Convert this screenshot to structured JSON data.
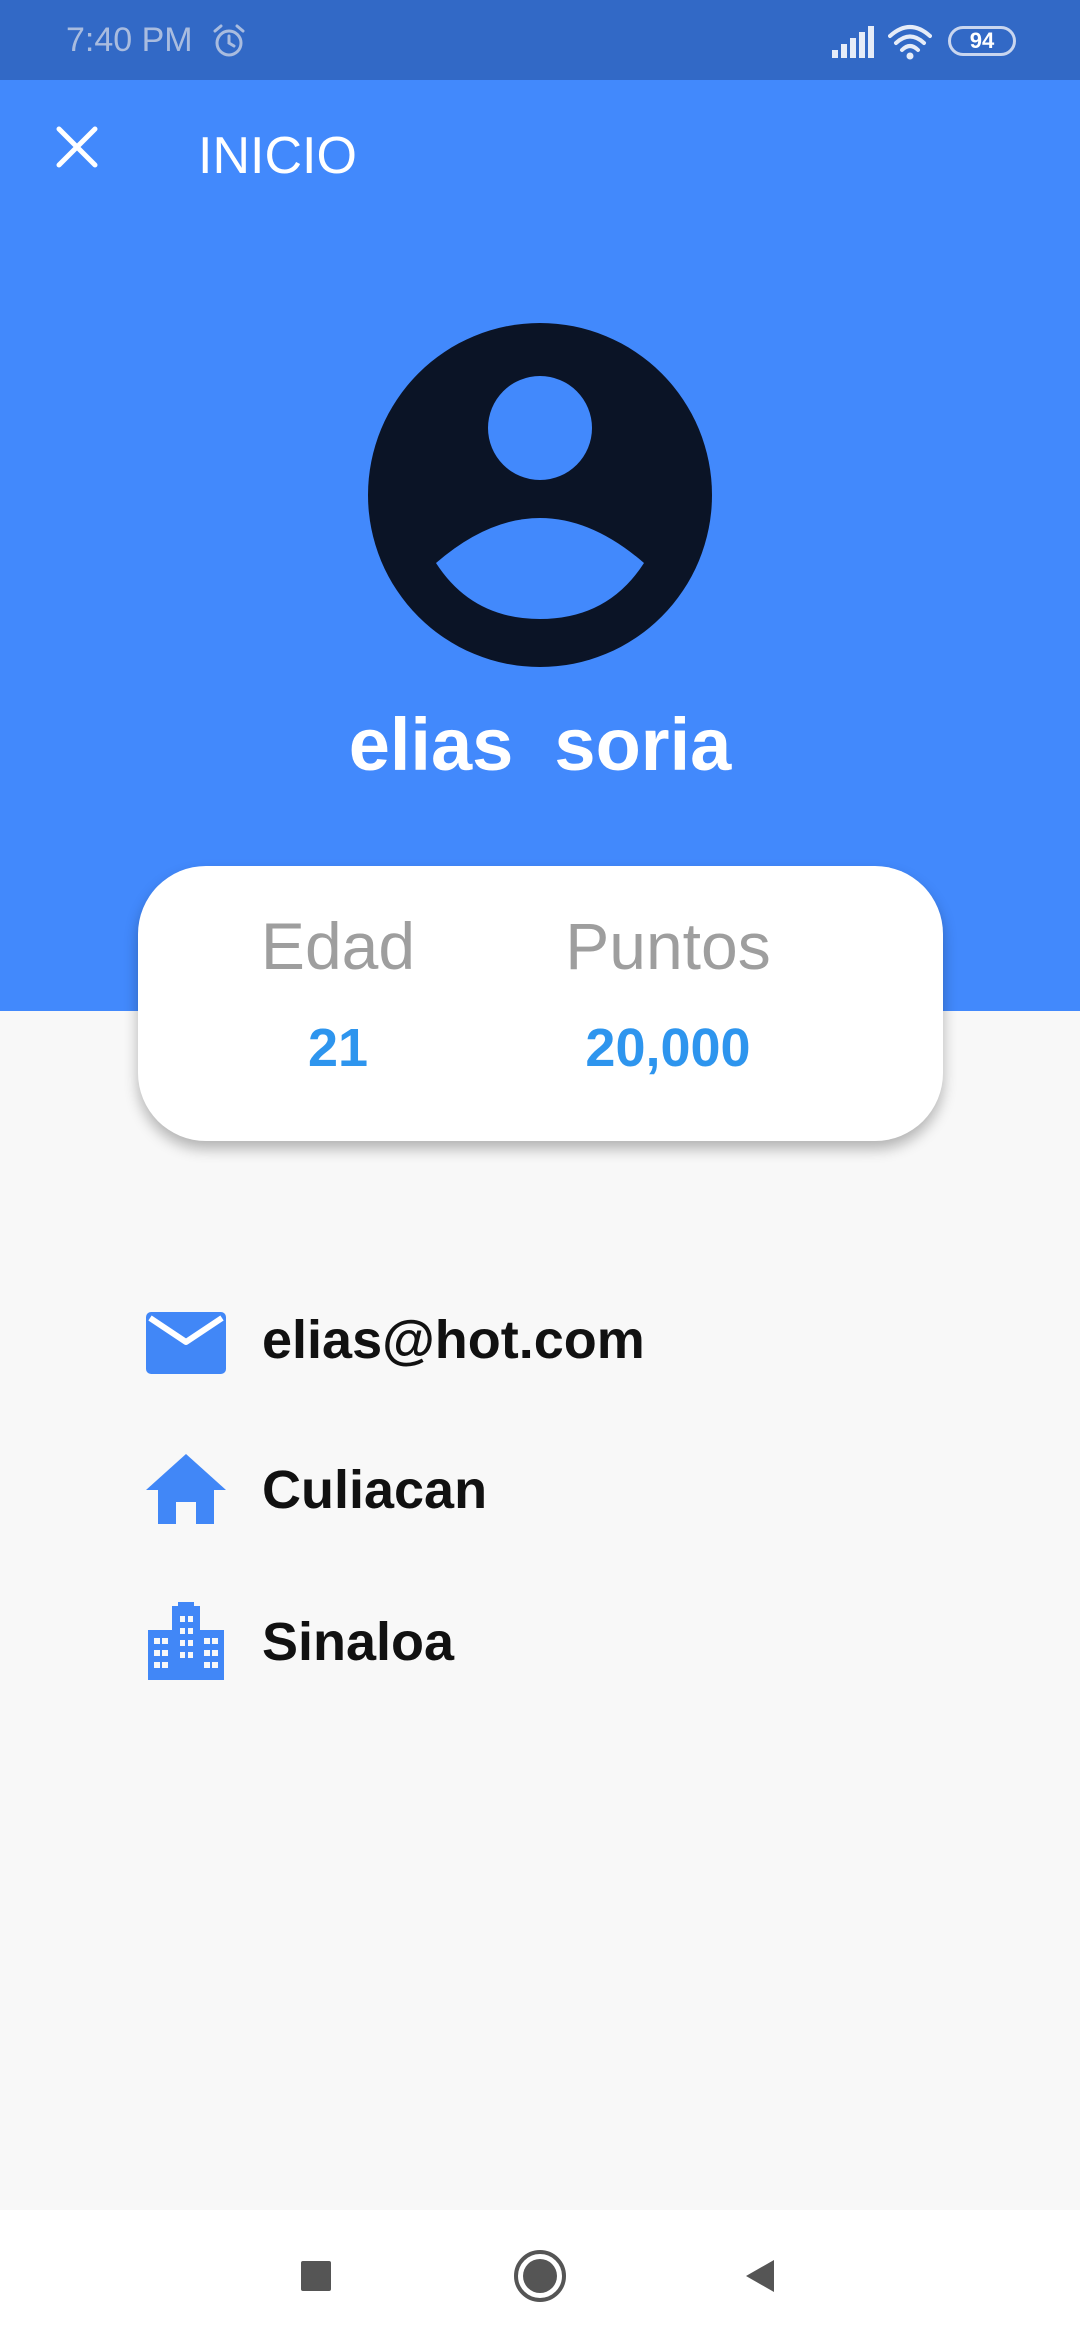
{
  "status_bar": {
    "time": "7:40 PM",
    "alarm_icon": "alarm-icon",
    "signal_icon": "signal-icon",
    "wifi_icon": "wifi-icon",
    "battery_level": "94"
  },
  "header": {
    "close_icon": "close-icon",
    "title": "INICIO"
  },
  "profile": {
    "avatar_icon": "account-circle-icon",
    "name": "elias  soria"
  },
  "stats": {
    "age_label": "Edad",
    "age_value": "21",
    "points_label": "Puntos",
    "points_value": "20,000"
  },
  "info": {
    "email": "elias@hot.com",
    "city": "Culiacan",
    "state": "Sinaloa",
    "email_icon": "email-icon",
    "city_icon": "home-icon",
    "state_icon": "city-buildings-icon"
  },
  "nav_bar": {
    "recents_icon": "square-recents-icon",
    "home_icon": "circle-home-icon",
    "back_icon": "triangle-back-icon"
  },
  "colors": {
    "status_bar": "#3269c6",
    "header_blue": "#4289fc",
    "avatar_dark": "#0b1426",
    "stat_value_blue": "#2e95ee",
    "stat_label_grey": "#9e9e9e",
    "icon_blue": "#4187f7"
  }
}
